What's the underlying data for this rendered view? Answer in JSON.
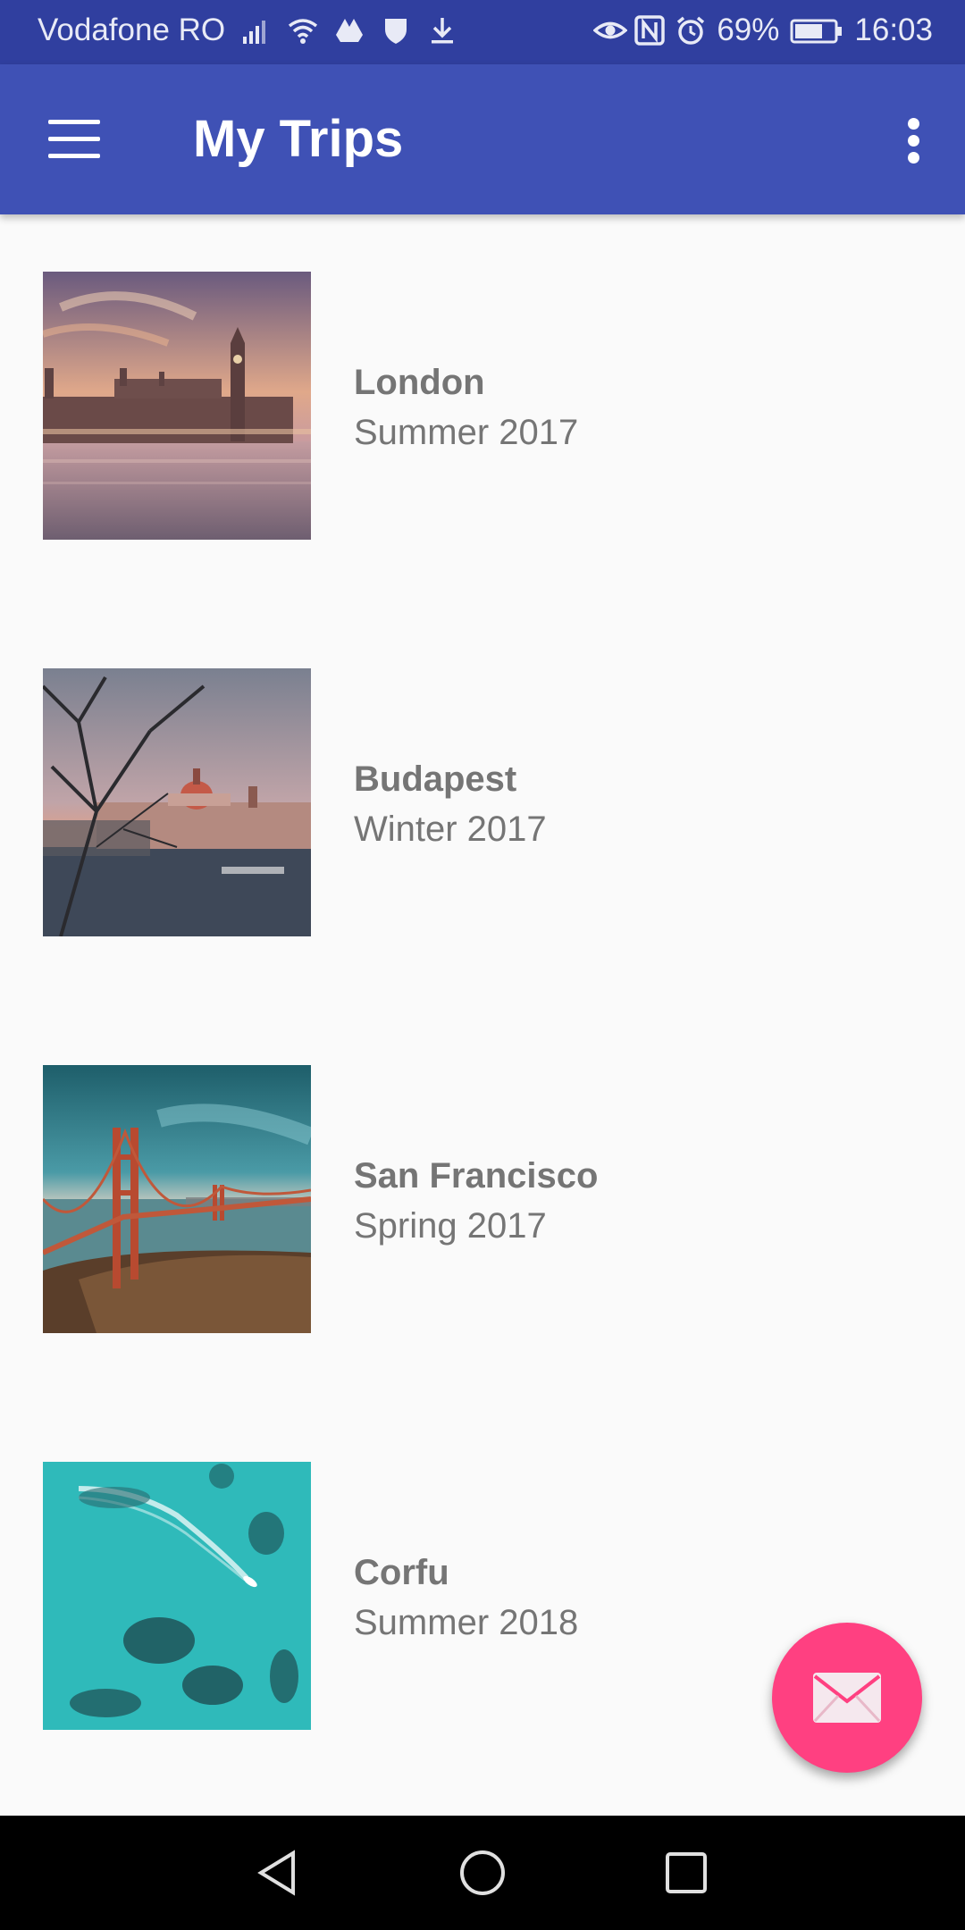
{
  "status_bar": {
    "carrier": "Vodafone RO",
    "battery": "69%",
    "time": "16:03",
    "icons_left": [
      "signal-icon",
      "wifi-icon",
      "drive-icon",
      "shield-icon",
      "download-icon"
    ],
    "icons_right": [
      "eye-icon",
      "nfc-icon",
      "alarm-icon",
      "battery-icon"
    ]
  },
  "app_bar": {
    "title": "My Trips",
    "menu_icon": "hamburger-menu-icon",
    "overflow_icon": "more-vert-icon",
    "color": "#3f51b5"
  },
  "trips": [
    {
      "city": "London",
      "season": "Summer 2017",
      "image": "london-parliament-photo"
    },
    {
      "city": "Budapest",
      "season": "Winter 2017",
      "image": "budapest-parliament-photo"
    },
    {
      "city": "San Francisco",
      "season": "Spring 2017",
      "image": "golden-gate-bridge-photo"
    },
    {
      "city": "Corfu",
      "season": "Summer 2018",
      "image": "turquoise-sea-boat-photo"
    }
  ],
  "fab": {
    "icon": "mail-icon",
    "color": "#ff4081"
  },
  "nav_bar": {
    "icons": [
      "back-icon",
      "home-icon",
      "recents-icon"
    ]
  }
}
